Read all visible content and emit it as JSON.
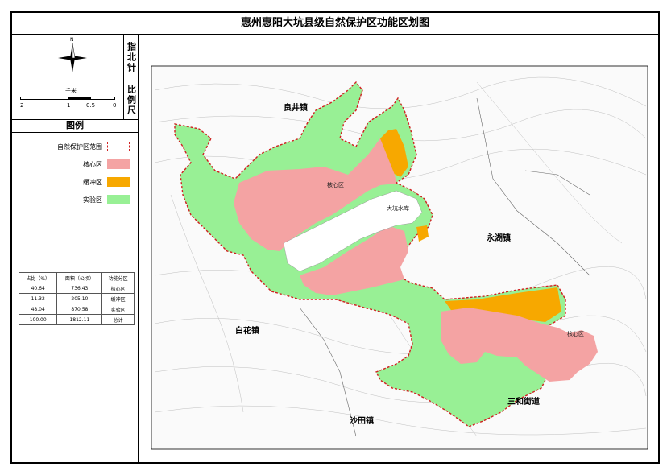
{
  "map": {
    "title": "惠州惠阳大坑县级自然保护区功能区划图",
    "north_label": "指北针",
    "north_letter": "N",
    "scale_label": "比例尺",
    "scale_unit": "千米",
    "scale_ticks": [
      "2",
      "1",
      "0.5",
      "0"
    ]
  },
  "legend": {
    "title": "图例",
    "items": [
      {
        "label": "自然保护区范围",
        "color": "#ffffff",
        "border": "#d02020",
        "style": "dashed"
      },
      {
        "label": "核心区",
        "color": "#f4a3a3"
      },
      {
        "label": "缓冲区",
        "color": "#f7a800"
      },
      {
        "label": "实验区",
        "color": "#98f095"
      }
    ]
  },
  "stats_table": {
    "headers": [
      "功能分区",
      "面积（公顷）",
      "占比（%）"
    ],
    "rows": [
      [
        "核心区",
        "736.43",
        "40.64"
      ],
      [
        "缓冲区",
        "205.10",
        "11.32"
      ],
      [
        "实验区",
        "870.58",
        "48.04"
      ],
      [
        "总计",
        "1812.11",
        "100.00"
      ]
    ]
  },
  "towns": {
    "liangjing": "良井镇",
    "yonghu": "永湖镇",
    "baihua": "白花镇",
    "sanhe": "三和街道",
    "shatian": "沙田镇"
  },
  "features": {
    "dakeng_reservoir": "大坑水库",
    "core_label_1": "核心区",
    "core_label_2": "核心区"
  }
}
